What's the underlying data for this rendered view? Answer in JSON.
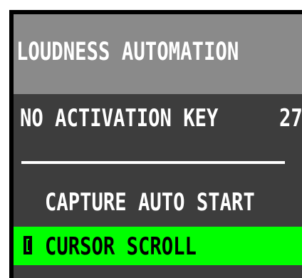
{
  "header": {
    "title": "LOUDNESS AUTOMATION"
  },
  "status_row": {
    "label": "NO ACTIVATION KEY",
    "count": "27"
  },
  "menu": {
    "items": [
      {
        "label": "CAPTURE AUTO START"
      },
      {
        "label": "CURSOR SCROLL",
        "selected": true
      }
    ]
  },
  "colors": {
    "panel_background": "#3d3d3d",
    "header_background": "#8a8a8a",
    "selection_highlight": "#00ff00",
    "text": "#ffffff"
  },
  "icons": {
    "selection_marker": "selection-marker-icon"
  }
}
